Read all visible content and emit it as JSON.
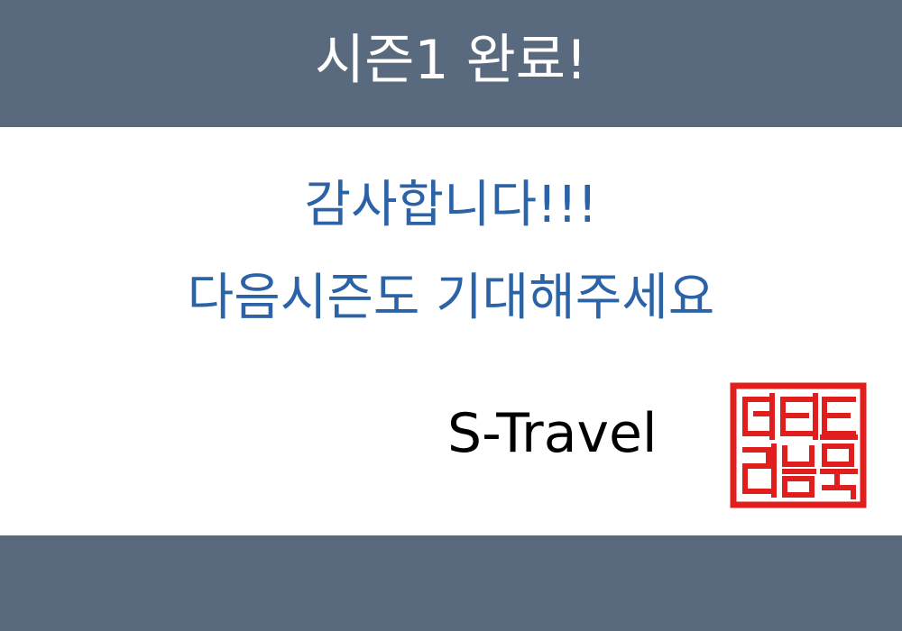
{
  "header": {
    "title": "시즌1 완료!"
  },
  "message": {
    "line1": "감사합니다!!!",
    "line2": "다음시즌도 기대해주세요"
  },
  "brand": {
    "name": "S-Travel"
  },
  "seal": {
    "text": "어티티 리블인",
    "color": "#e01e1e"
  },
  "colors": {
    "band": "#5a6a7e",
    "message": "#2b63a6",
    "background": "#ffffff"
  }
}
